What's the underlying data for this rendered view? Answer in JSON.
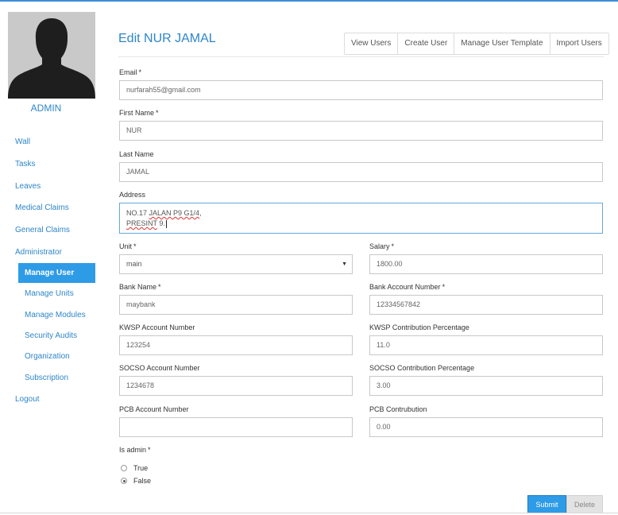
{
  "user": {
    "role_label": "ADMIN"
  },
  "sidebar": {
    "items": [
      {
        "label": "Wall"
      },
      {
        "label": "Tasks"
      },
      {
        "label": "Leaves"
      },
      {
        "label": "Medical Claims"
      },
      {
        "label": "General Claims"
      },
      {
        "label": "Administrator"
      },
      {
        "label": "Manage User"
      },
      {
        "label": "Manage Units"
      },
      {
        "label": "Manage Modules"
      },
      {
        "label": "Security Audits"
      },
      {
        "label": "Organization"
      },
      {
        "label": "Subscription"
      },
      {
        "label": "Logout"
      }
    ],
    "active_item": "Manage User"
  },
  "header": {
    "title": "Edit NUR JAMAL",
    "tabs": [
      {
        "label": "View Users"
      },
      {
        "label": "Create User"
      },
      {
        "label": "Manage User Template"
      },
      {
        "label": "Import Users"
      }
    ]
  },
  "form": {
    "required_mark": "*",
    "email": {
      "label": "Email",
      "value": "nurfarah55@gmail.com"
    },
    "first_name": {
      "label": "First Name",
      "value": "NUR"
    },
    "last_name": {
      "label": "Last Name",
      "value": "JAMAL"
    },
    "address": {
      "label": "Address",
      "line1_prefix": "NO.17 ",
      "line1_misspelled": "JALAN P9 G1/4",
      "line1_suffix": ",",
      "line2_misspelled": "PRESINT",
      "line2_suffix": " 9."
    },
    "unit": {
      "label": "Unit",
      "value": "main",
      "arrow": "▼"
    },
    "salary": {
      "label": "Salary",
      "value": "1800.00"
    },
    "bank_name": {
      "label": "Bank Name",
      "value": "maybank"
    },
    "bank_account": {
      "label": "Bank Account Number",
      "value": "12334567842"
    },
    "kwsp_account": {
      "label": "KWSP Account Number",
      "value": "123254"
    },
    "kwsp_pct": {
      "label": "KWSP Contribution Percentage",
      "value": "11.0"
    },
    "socso_account": {
      "label": "SOCSO Account Number",
      "value": "1234678"
    },
    "socso_pct": {
      "label": "SOCSO Contribution Percentage",
      "value": "3.00"
    },
    "pcb_account": {
      "label": "PCB Account Number",
      "value": ""
    },
    "pcb_contribution": {
      "label": "PCB Contrubution",
      "value": "0.00"
    },
    "is_admin": {
      "label": "Is admin",
      "options": [
        "True",
        "False"
      ],
      "selected": "False"
    }
  },
  "actions": {
    "submit_label": "Submit",
    "delete_label": "Delete"
  },
  "colors": {
    "accent": "#2e9be6",
    "link": "#2e86c9"
  }
}
